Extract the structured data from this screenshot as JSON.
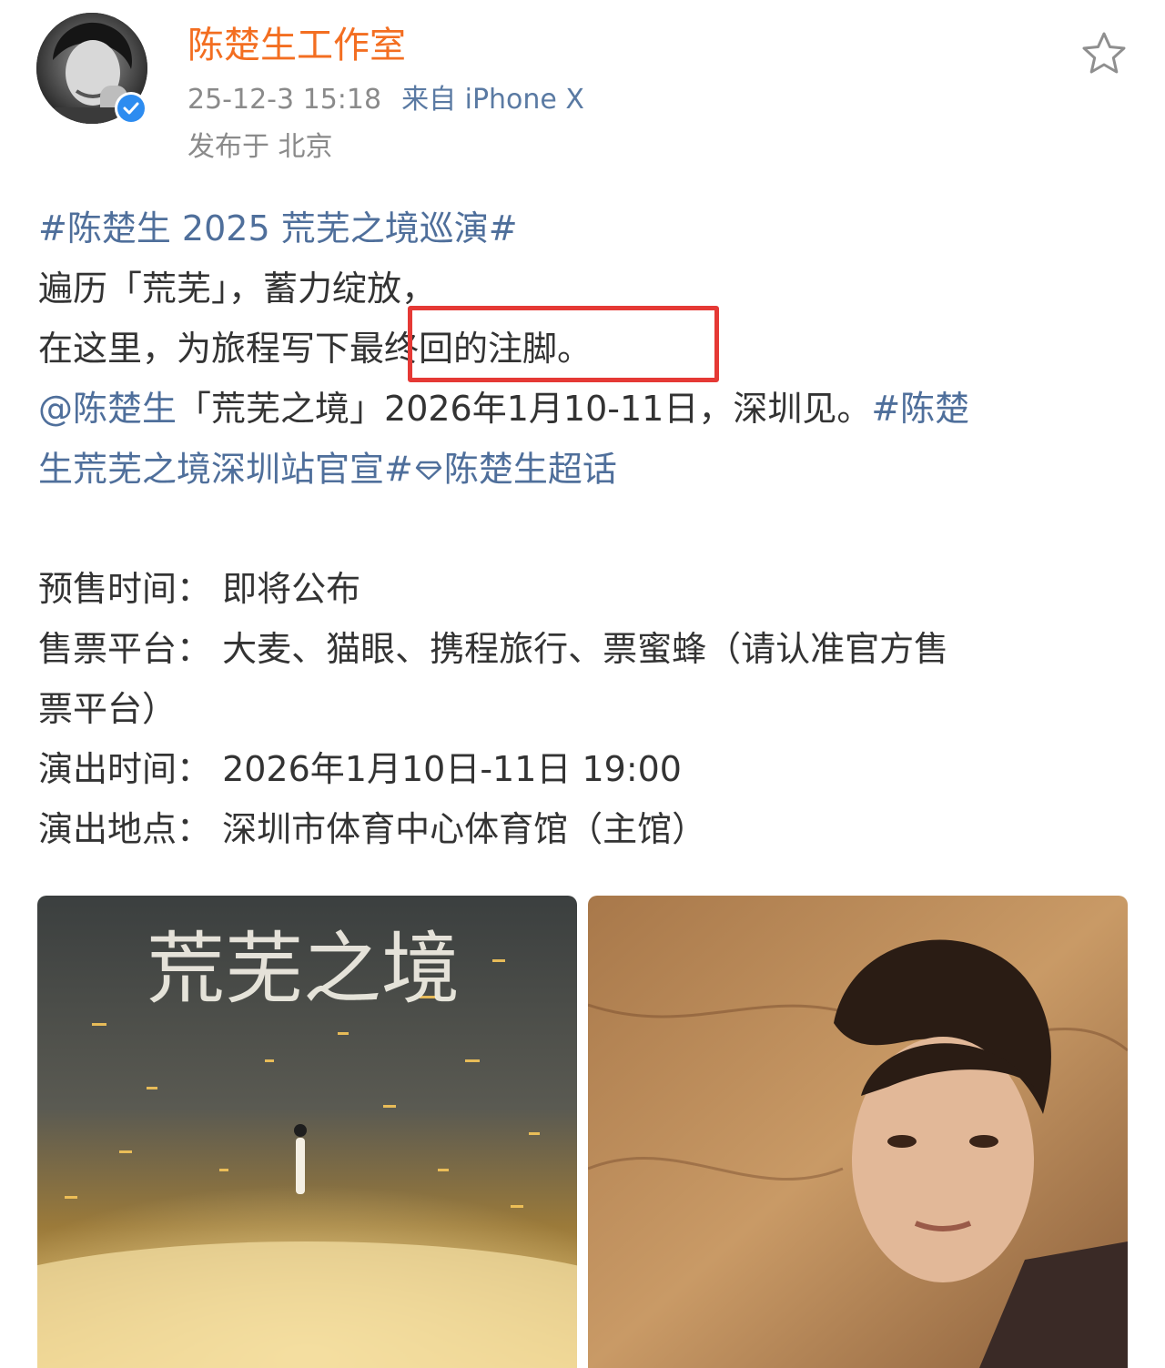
{
  "header": {
    "username": "陈楚生工作室",
    "time": "25-12-3 15:18",
    "source": "来自 iPhone X",
    "location": "发布于 北京",
    "icons": {
      "avatar": "avatar-photo",
      "verified": "verified-check-icon",
      "favorite": "star-outline-icon"
    }
  },
  "post": {
    "hashtag_tour": "#陈楚生 2025 荒芜之境巡演#",
    "line1": "遍历「荒芜」，蓄力绽放，",
    "line2_prefix": "在这里，为旅程写下",
    "line2_highlight": "最终回的注脚。",
    "line3_mention": "@陈楚生",
    "line3_text": "「荒芜之境」2026年1月10-11日，深圳见。",
    "line3_hashtag_start": "#陈楚",
    "line4_hashtag_end": "生荒芜之境深圳站官宣#",
    "line4_supertopic": "陈楚生超话",
    "presale": "预售时间：  即将公布",
    "platform_line1": "售票平台：  大麦、猫眼、携程旅行、票蜜蜂（请认准官方售",
    "platform_line2": "票平台）",
    "showtime": "演出时间：  2026年1月10日-11日 19:00",
    "venue": "演出地点：  深圳市体育中心体育馆（主馆）"
  },
  "images": {
    "left_title": "荒芜之境"
  },
  "colors": {
    "username": "#f36e21",
    "link": "#4f6f9b",
    "text": "#333333",
    "meta": "#8a8a8a",
    "highlight_border": "#e53935",
    "verified": "#2d8cf0"
  }
}
